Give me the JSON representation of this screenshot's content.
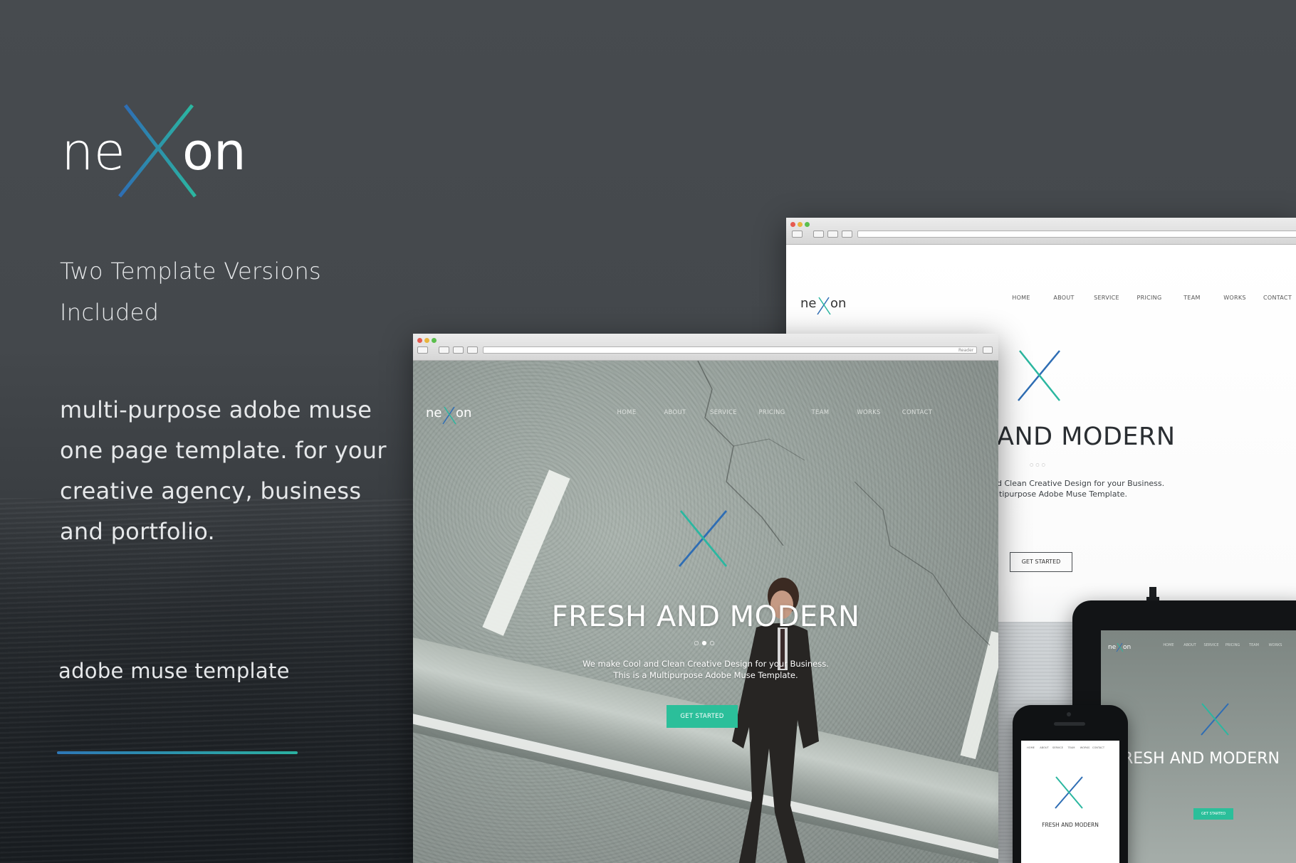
{
  "brand": {
    "logo_text": "neXon",
    "logo_prefix": "ne",
    "logo_mid": "X",
    "logo_suffix": "on"
  },
  "left": {
    "tagline_line1": "Two Template Versions",
    "tagline_line2": "Included",
    "description_lines": [
      "multi-purpose adobe muse",
      "one page template. for your",
      "creative agency, business",
      "and portfolio."
    ],
    "subtitle": "adobe muse template"
  },
  "colors": {
    "accent_blue": "#2e77b6",
    "accent_teal": "#2bb0a0",
    "button_green": "#2bbf9a"
  },
  "nav": [
    "HOME",
    "ABOUT",
    "SERVICE",
    "PRICING",
    "TEAM",
    "WORKS",
    "CONTACT"
  ],
  "front_browser": {
    "headline": "FRESH AND MODERN",
    "sub_line1": "We make Cool and Clean Creative Design for your Business.",
    "sub_line2": "This is a Multipurpose Adobe Muse Template.",
    "button": "GET STARTED",
    "reader": "Reader"
  },
  "back_browser": {
    "headline": "AND MODERN",
    "sub_line1": "d Clean Creative Design for your Business.",
    "sub_line2": "ltipurpose Adobe Muse Template.",
    "button": "GET STARTED"
  },
  "tablet": {
    "headline": "RESH AND MODERN",
    "button": "GET STARTED"
  },
  "phone": {
    "headline": "FRESH AND MODERN"
  },
  "icons": [
    "x-logo-icon",
    "close-dot-icon",
    "minimize-dot-icon",
    "maximize-dot-icon",
    "back-icon",
    "forward-icon",
    "share-icon",
    "reload-icon",
    "add-tab-icon"
  ]
}
